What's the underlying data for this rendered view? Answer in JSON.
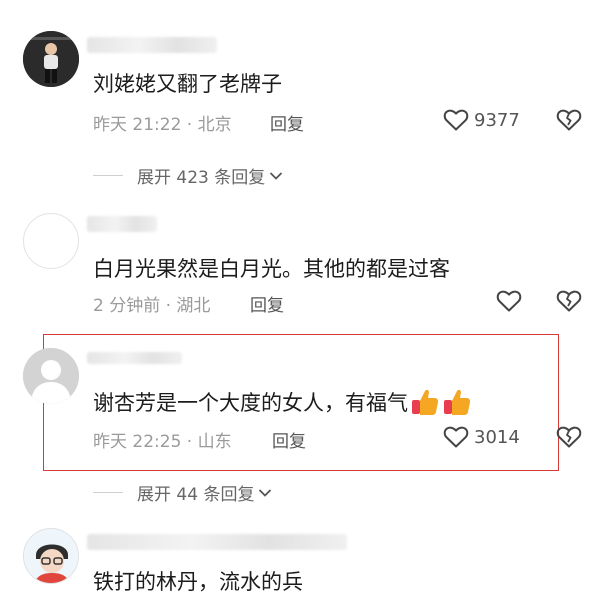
{
  "comments": [
    {
      "text": "刘姥姥又翻了老牌子",
      "time": "昨天 21:22 · 北京",
      "reply": "回复",
      "likes": "9377",
      "expand": "展开 423 条回复"
    },
    {
      "text": "白月光果然是白月光。其他的都是过客",
      "time": "2 分钟前 · 湖北",
      "reply": "回复",
      "likes": ""
    },
    {
      "text": "谢杏芳是一个大度的女人，有福气",
      "emoji": [
        "thumbs-up",
        "thumbs-up"
      ],
      "time": "昨天 22:25 · 山东",
      "reply": "回复",
      "likes": "3014",
      "expand": "展开 44 条回复"
    },
    {
      "text": "铁打的林丹，流水的兵"
    }
  ],
  "colors": {
    "highlight": "#d83a3a",
    "thumb": "#f5a623",
    "thumb_cuff": "#e83d4f"
  }
}
